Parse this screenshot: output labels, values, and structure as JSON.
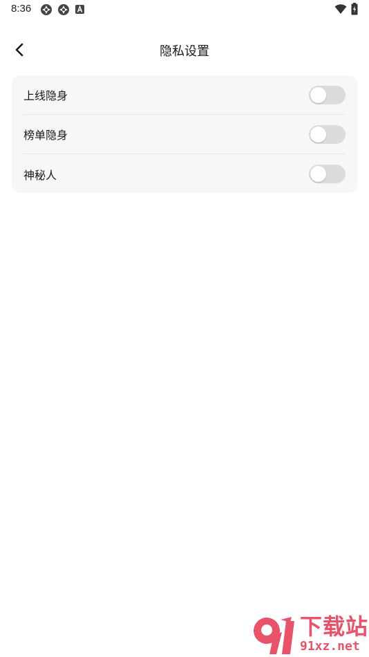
{
  "status_bar": {
    "time": "8:36",
    "icons": [
      "app-notification-icon",
      "app-notification-icon",
      "keyboard-a-icon",
      "wifi-icon",
      "battery-charging-icon"
    ]
  },
  "header": {
    "back_icon": "chevron-left-icon",
    "title": "隐私设置"
  },
  "settings": {
    "items": [
      {
        "label": "上线隐身",
        "enabled": false
      },
      {
        "label": "榜单隐身",
        "enabled": false
      },
      {
        "label": "神秘人",
        "enabled": false
      }
    ]
  },
  "watermark": {
    "logo_text": "9",
    "title": "下载站",
    "url": "91xz.net",
    "color": "#e8536a"
  },
  "colors": {
    "background": "#ffffff",
    "card": "#f6f7f9",
    "toggle_off": "#dcdcdc",
    "divider": "#e8e9ec"
  }
}
